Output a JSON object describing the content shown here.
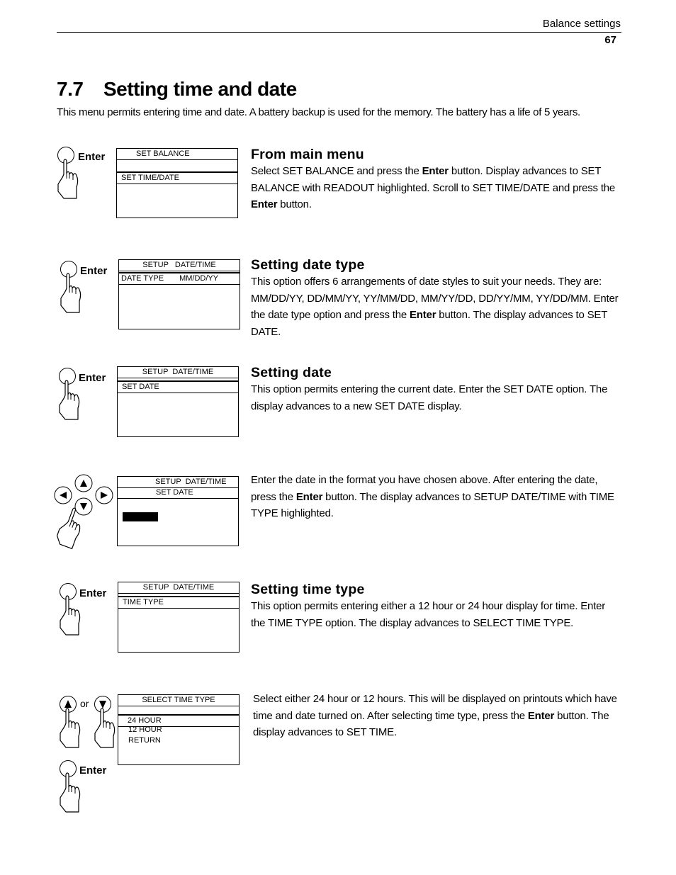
{
  "header": {
    "section_name": "Balance settings",
    "page_number": "67"
  },
  "section": {
    "number": "7.7",
    "title": "Setting time and date",
    "intro": "This menu permits entering time and date. A battery backup is used for the memory. The battery has a life of 5 years."
  },
  "steps": [
    {
      "heading": "From main menu",
      "key": "Enter",
      "text_parts": [
        "Select SET BALANCE and press the ",
        "Enter",
        " button. Display advances to SET BALANCE with READOUT highlighted. Scroll to SET TIME/DATE and press the ",
        "Enter",
        " button."
      ],
      "display": {
        "title": "SET BALANCE",
        "selected": "SET TIME/DATE"
      }
    },
    {
      "heading": "Setting date type",
      "key": "Enter",
      "text_parts": [
        "This option offers 6 arrangements of date styles to suit your needs. They are: MM/DD/YY, DD/MM/YY, YY/MM/DD, MM/YY/DD, DD/YY/MM, YY/DD/MM. Enter the date type option and press the ",
        "Enter",
        " button. The display advances to SET DATE."
      ],
      "display": {
        "title": "SETUP   DATE/TIME",
        "selected_label": "DATE TYPE",
        "selected_value": "MM/DD/YY"
      }
    },
    {
      "heading": "Setting date",
      "key": "Enter",
      "text_parts": [
        "This option permits entering the current date. Enter the SET DATE option. The display advances to a new SET DATE display."
      ],
      "display": {
        "title": "SETUP  DATE/TIME",
        "selected": "SET DATE"
      }
    },
    {
      "heading": "",
      "keys": [
        "up-arrow",
        "left-arrow",
        "right-arrow",
        "down-arrow"
      ],
      "text_parts": [
        "Enter the date in the format you have chosen above. After entering the date, press the ",
        "Enter",
        " button. The display advances to SETUP DATE/TIME with TIME TYPE highlighted."
      ],
      "display": {
        "title": "SETUP  DATE/TIME",
        "subtitle": "SET DATE"
      }
    },
    {
      "heading": "Setting time type",
      "key": "Enter",
      "text_parts": [
        "This option permits entering either a 12 hour or 24 hour display for time. Enter the TIME TYPE option. The display advances to SELECT TIME TYPE."
      ],
      "display": {
        "title": "SETUP  DATE/TIME",
        "selected": "TIME TYPE"
      }
    },
    {
      "heading": "",
      "or_label": "or",
      "key": "Enter",
      "text_parts": [
        "Select either 24 hour or 12 hours. This will be displayed on printouts which have time and date turned on. After selecting time type, press the ",
        "Enter",
        " button. The display advances to SET TIME."
      ],
      "display": {
        "title": "SELECT TIME TYPE",
        "selected": "24 HOUR",
        "options": [
          "12 HOUR",
          "RETURN"
        ]
      }
    }
  ]
}
